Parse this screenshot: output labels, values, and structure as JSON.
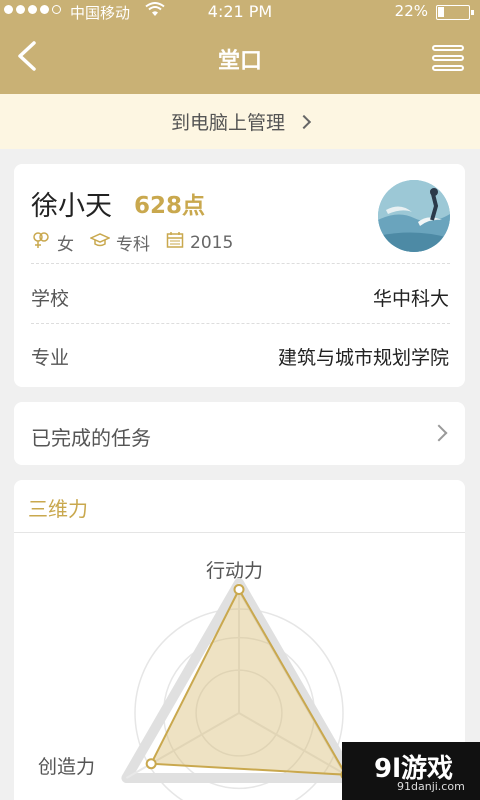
{
  "status_bar": {
    "carrier": "中国移动",
    "time": "4:21 PM",
    "battery": "22%",
    "battery_level": 0.22
  },
  "nav": {
    "title": "堂口"
  },
  "pc_manage": {
    "label": "到电脑上管理"
  },
  "profile": {
    "name": "徐小天",
    "points": "628点",
    "gender": "女",
    "education": "专科",
    "year": "2015",
    "rows": [
      {
        "label": "学校",
        "value": "华中科大"
      },
      {
        "label": "专业",
        "value": "建筑与城市规划学院"
      }
    ]
  },
  "tasks": {
    "label": "已完成的任务"
  },
  "radar": {
    "title": "三维力",
    "axes": [
      "行动力",
      "创造力",
      ""
    ],
    "values": [
      0.95,
      0.78,
      0.95
    ],
    "accent": "#d9bf7a"
  },
  "watermark": {
    "brand": "9l游戏",
    "domain": "91danji.com"
  }
}
